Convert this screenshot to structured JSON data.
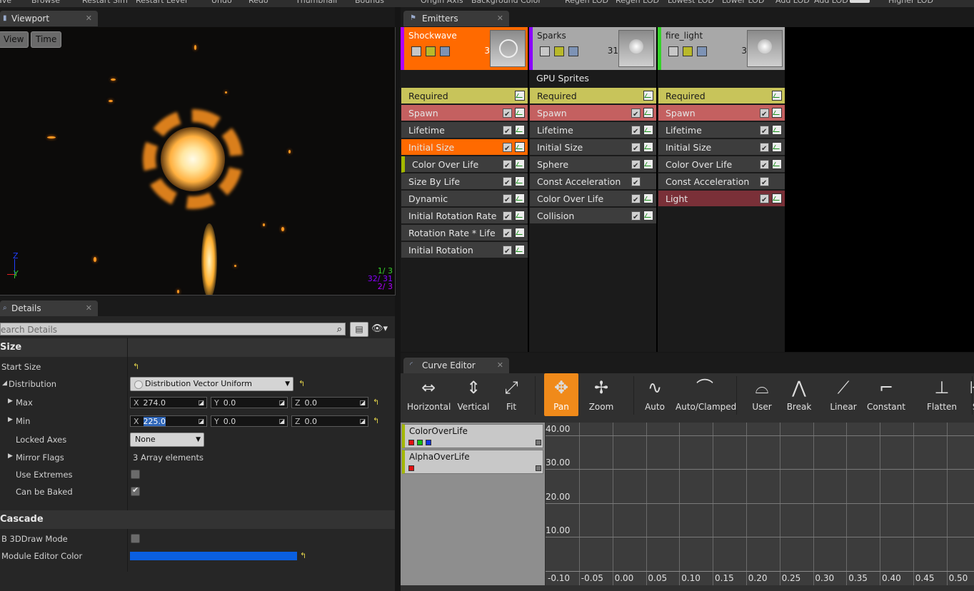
{
  "topbar": {
    "items": [
      "ave",
      "Browse",
      "Restart Sim",
      "Restart Level",
      "Undo",
      "Redo",
      "Thumbnail",
      "Bounds",
      "Origin Axis",
      "Background Color",
      "Regen LOD",
      "Regen LOD",
      "Lowest LOD",
      "Lower LOD",
      "Add LOD",
      "Add LOD",
      "Higher LOD"
    ]
  },
  "viewport": {
    "tab": "Viewport",
    "view_btn": "View",
    "time_btn": "Time",
    "axis_z": "Z",
    "axis_y": "Y",
    "stats": [
      "1/  3",
      "32/ 31",
      "2/  3"
    ]
  },
  "details": {
    "tab": "Details",
    "search_placeholder": "earch Details",
    "cat_size": "Size",
    "start_size": "Start Size",
    "distribution": "Distribution",
    "distribution_value": "Distribution Vector Uniform",
    "max": "Max",
    "min": "Min",
    "max_x": "274.0",
    "max_y": "0.0",
    "max_z": "0.0",
    "min_x": "225.0",
    "min_y": "0.0",
    "min_z": "0.0",
    "axis_x": "X",
    "axis_y": "Y",
    "axis_z": "Z",
    "locked_axes": "Locked Axes",
    "locked_axes_value": "None",
    "mirror_flags": "Mirror Flags",
    "mirror_flags_value": "3 Array elements",
    "use_extremes": "Use Extremes",
    "can_be_baked": "Can be Baked",
    "cat_cascade": "Cascade",
    "b3d": "B 3DDraw Mode",
    "module_color": "Module Editor Color",
    "module_color_hex": "#0a5fe0"
  },
  "emitters": {
    "tab": "Emitters",
    "columns": [
      {
        "name": "Shockwave",
        "count": "3",
        "header_color": "#ff6a00",
        "accent": "#b000ff",
        "subheader": "",
        "modules": [
          {
            "label": "Required",
            "color": "#c8c45a",
            "dark": true
          },
          {
            "label": "Spawn",
            "color": "#c46060",
            "dark": false
          },
          {
            "label": "Lifetime",
            "color": "#3d3d3d",
            "dark": false
          },
          {
            "label": "Initial Size",
            "color": "#ff6a00",
            "dark": false
          },
          {
            "label": "Color Over Life",
            "color": "#3d3d3d",
            "dark": false,
            "mark": "#a4b800"
          },
          {
            "label": "Size By Life",
            "color": "#3d3d3d",
            "dark": false
          },
          {
            "label": "Dynamic",
            "color": "#3d3d3d",
            "dark": false
          },
          {
            "label": "Initial Rotation Rate",
            "color": "#3d3d3d",
            "dark": false
          },
          {
            "label": "Rotation Rate * Life",
            "color": "#3d3d3d",
            "dark": false
          },
          {
            "label": "Initial Rotation",
            "color": "#3d3d3d",
            "dark": false
          }
        ]
      },
      {
        "name": "Sparks",
        "count": "31",
        "header_color": "#a8a8a8",
        "accent": "#8a00ff",
        "subheader": "GPU Sprites",
        "modules": [
          {
            "label": "Required",
            "color": "#c8c45a",
            "dark": true
          },
          {
            "label": "Spawn",
            "color": "#c46060",
            "dark": false
          },
          {
            "label": "Lifetime",
            "color": "#3d3d3d",
            "dark": false
          },
          {
            "label": "Initial Size",
            "color": "#3d3d3d",
            "dark": false
          },
          {
            "label": "Sphere",
            "color": "#3d3d3d",
            "dark": false
          },
          {
            "label": "Const Acceleration",
            "color": "#3d3d3d",
            "dark": false,
            "nograph": true
          },
          {
            "label": "Color Over Life",
            "color": "#3d3d3d",
            "dark": false
          },
          {
            "label": "Collision",
            "color": "#3d3d3d",
            "dark": false
          }
        ]
      },
      {
        "name": "fire_light",
        "count": "3",
        "header_color": "#a8a8a8",
        "accent": "#36d12a",
        "subheader": "",
        "modules": [
          {
            "label": "Required",
            "color": "#c8c45a",
            "dark": true
          },
          {
            "label": "Spawn",
            "color": "#c46060",
            "dark": false
          },
          {
            "label": "Lifetime",
            "color": "#3d3d3d",
            "dark": false
          },
          {
            "label": "Initial Size",
            "color": "#3d3d3d",
            "dark": false
          },
          {
            "label": "Color Over Life",
            "color": "#3d3d3d",
            "dark": false
          },
          {
            "label": "Const Acceleration",
            "color": "#3d3d3d",
            "dark": false,
            "nograph": true
          },
          {
            "label": "Light",
            "color": "#7a3038",
            "dark": false
          }
        ]
      }
    ]
  },
  "curve_editor": {
    "tab": "Curve Editor",
    "toolbar": [
      {
        "label": "Horizontal",
        "icon": "horizontal-icon",
        "glyph": "⇔"
      },
      {
        "label": "Vertical",
        "icon": "vertical-icon",
        "glyph": "⇕"
      },
      {
        "label": "Fit",
        "icon": "fit-icon",
        "glyph": "⤢"
      },
      {
        "label": "Pan",
        "icon": "pan-icon",
        "glyph": "✥",
        "active": true
      },
      {
        "label": "Zoom",
        "icon": "zoom-icon",
        "glyph": "✢"
      },
      {
        "label": "Auto",
        "icon": "auto-icon",
        "glyph": "∿"
      },
      {
        "label": "Auto/Clamped",
        "icon": "auto-clamped-icon",
        "glyph": "⌒"
      },
      {
        "label": "User",
        "icon": "user-icon",
        "glyph": "⌓"
      },
      {
        "label": "Break",
        "icon": "break-icon",
        "glyph": "⋀"
      },
      {
        "label": "Linear",
        "icon": "linear-icon",
        "glyph": "⟋"
      },
      {
        "label": "Constant",
        "icon": "constant-icon",
        "glyph": "⌐"
      },
      {
        "label": "Flatten",
        "icon": "flatten-icon",
        "glyph": "⊥"
      },
      {
        "label": "St",
        "icon": "straighten-icon",
        "glyph": "⊢"
      }
    ],
    "tracks": [
      {
        "name": "ColorOverLife",
        "swatches": [
          "#e01010",
          "#10c010",
          "#1030e0"
        ],
        "accent": "#a4b800"
      },
      {
        "name": "AlphaOverLife",
        "swatches": [
          "#e01010"
        ],
        "accent": "#a4b800"
      }
    ],
    "y_labels": [
      "40.00",
      "30.00",
      "20.00",
      "10.00"
    ],
    "x_labels": [
      "-0.10",
      "-0.05",
      "0.00",
      "0.05",
      "0.10",
      "0.15",
      "0.20",
      "0.25",
      "0.30",
      "0.35",
      "0.40",
      "0.45",
      "0.50"
    ]
  }
}
